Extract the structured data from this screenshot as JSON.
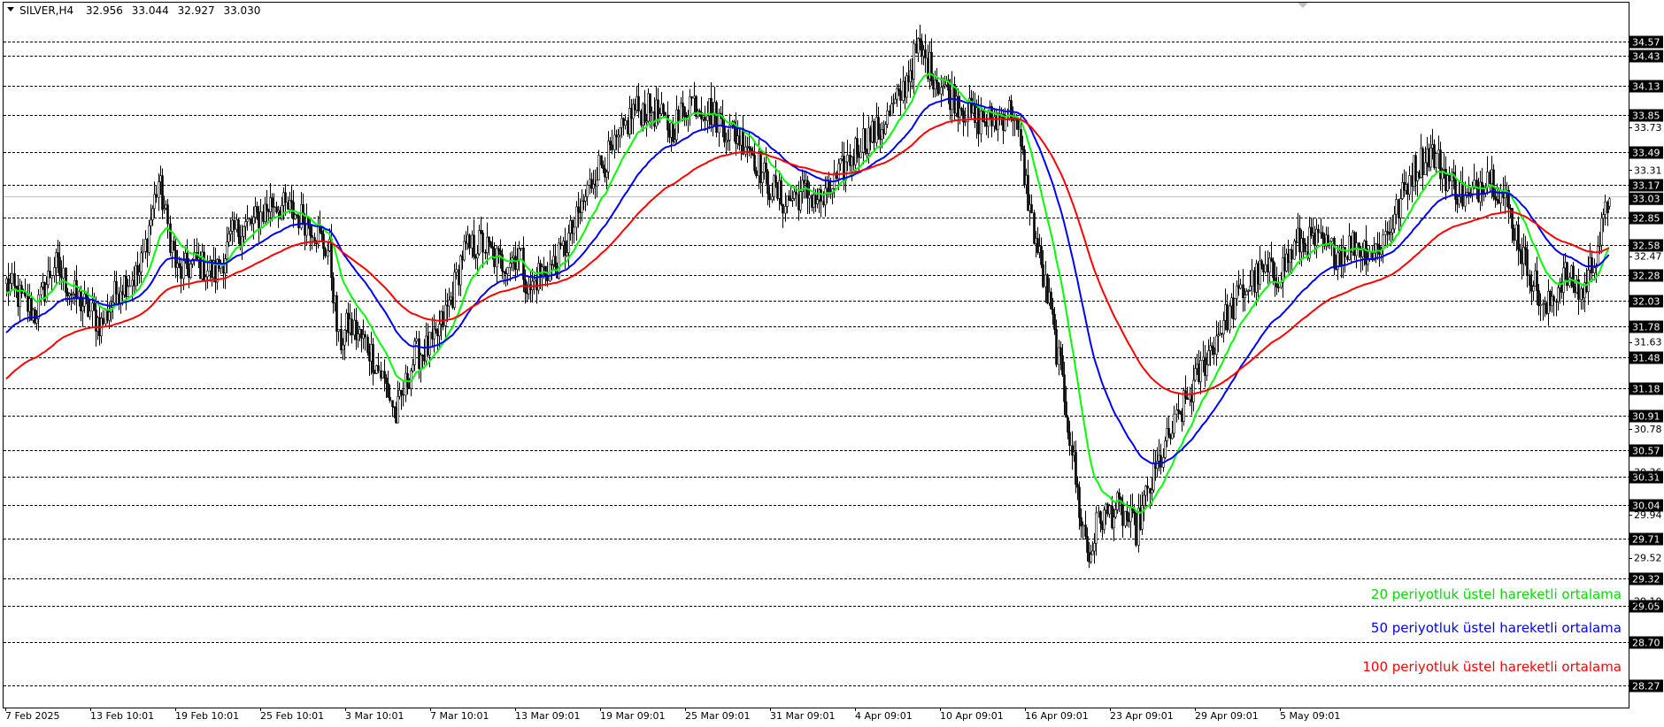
{
  "chart_data": {
    "type": "candlestick",
    "title": {
      "symbol": "SILVER,H4",
      "open": "32.956",
      "high": "33.044",
      "low": "32.927",
      "close": "33.030"
    },
    "y_range": [
      28.1,
      34.8
    ],
    "time_labels": [
      "7 Feb 2025",
      "13 Feb 10:01",
      "19 Feb 10:01",
      "25 Feb 10:01",
      "3 Mar 10:01",
      "7 Mar 10:01",
      "13 Mar 09:01",
      "19 Mar 09:01",
      "25 Mar 09:01",
      "31 Mar 09:01",
      "4 Apr 09:01",
      "10 Apr 09:01",
      "16 Apr 09:01",
      "23 Apr 09:01",
      "29 Apr 09:01",
      "5 May 09:01"
    ],
    "level_lines": [
      "34.57",
      "34.43",
      "34.13",
      "33.85",
      "33.49",
      "33.17",
      "32.85",
      "32.58",
      "32.28",
      "32.03",
      "31.78",
      "31.48",
      "31.18",
      "30.91",
      "30.57",
      "30.31",
      "30.04",
      "29.71",
      "29.32",
      "29.05",
      "28.70",
      "28.27"
    ],
    "scale_labels": [
      "33.73",
      "33.31",
      "32.47",
      "31.63",
      "30.78",
      "30.36",
      "29.94",
      "29.52",
      "29.10"
    ],
    "current_price": "33.03",
    "price_path": [
      [
        0,
        32.2
      ],
      [
        15,
        31.9
      ],
      [
        25,
        32.4
      ],
      [
        35,
        32.1
      ],
      [
        50,
        31.8
      ],
      [
        60,
        32.2
      ],
      [
        70,
        32.3
      ],
      [
        80,
        33.2
      ],
      [
        90,
        32.3
      ],
      [
        100,
        32.4
      ],
      [
        110,
        32.3
      ],
      [
        120,
        32.7
      ],
      [
        130,
        32.8
      ],
      [
        140,
        33.0
      ],
      [
        150,
        32.9
      ],
      [
        160,
        32.8
      ],
      [
        170,
        32.5
      ],
      [
        175,
        31.6
      ],
      [
        180,
        31.8
      ],
      [
        190,
        31.6
      ],
      [
        200,
        31.2
      ],
      [
        205,
        30.9
      ],
      [
        210,
        31.2
      ],
      [
        215,
        31.5
      ],
      [
        225,
        31.6
      ],
      [
        235,
        32.1
      ],
      [
        240,
        32.5
      ],
      [
        250,
        32.6
      ],
      [
        260,
        32.4
      ],
      [
        270,
        32.5
      ],
      [
        275,
        32.1
      ],
      [
        280,
        32.3
      ],
      [
        290,
        32.4
      ],
      [
        300,
        32.8
      ],
      [
        310,
        33.3
      ],
      [
        320,
        33.5
      ],
      [
        330,
        33.9
      ],
      [
        340,
        33.9
      ],
      [
        350,
        33.7
      ],
      [
        360,
        34.0
      ],
      [
        370,
        33.9
      ],
      [
        380,
        33.7
      ],
      [
        390,
        33.6
      ],
      [
        400,
        33.2
      ],
      [
        410,
        33.0
      ],
      [
        420,
        33.1
      ],
      [
        430,
        33.0
      ],
      [
        440,
        33.3
      ],
      [
        450,
        33.6
      ],
      [
        460,
        33.7
      ],
      [
        470,
        34.0
      ],
      [
        480,
        34.5
      ],
      [
        490,
        34.2
      ],
      [
        500,
        34.0
      ],
      [
        510,
        33.8
      ],
      [
        520,
        33.8
      ],
      [
        530,
        33.9
      ],
      [
        535,
        33.4
      ],
      [
        540,
        32.8
      ],
      [
        550,
        31.9
      ],
      [
        558,
        31.0
      ],
      [
        565,
        30.0
      ],
      [
        570,
        29.5
      ],
      [
        575,
        29.9
      ],
      [
        585,
        30.0
      ],
      [
        595,
        29.8
      ],
      [
        600,
        30.1
      ],
      [
        610,
        30.6
      ],
      [
        620,
        31.0
      ],
      [
        630,
        31.4
      ],
      [
        640,
        31.8
      ],
      [
        650,
        32.1
      ],
      [
        660,
        32.3
      ],
      [
        670,
        32.3
      ],
      [
        680,
        32.6
      ],
      [
        690,
        32.6
      ],
      [
        700,
        32.5
      ],
      [
        710,
        32.6
      ],
      [
        720,
        32.5
      ],
      [
        730,
        32.8
      ],
      [
        740,
        33.3
      ],
      [
        750,
        33.5
      ],
      [
        760,
        33.2
      ],
      [
        770,
        33.0
      ],
      [
        780,
        33.3
      ],
      [
        790,
        33.0
      ],
      [
        800,
        32.4
      ],
      [
        805,
        32.2
      ],
      [
        810,
        31.9
      ],
      [
        820,
        32.3
      ],
      [
        830,
        32.1
      ],
      [
        835,
        32.4
      ],
      [
        840,
        32.7
      ],
      [
        844,
        33.03
      ]
    ],
    "series": [
      {
        "name": "20 periyotluk üstel hareketli ortalama",
        "color": "#00ff00",
        "period": 20
      },
      {
        "name": "50 periyotluk üstel hareketli ortalama",
        "color": "#0000ff",
        "period": 50
      },
      {
        "name": "100 periyotluk üstel hareketli ortalama",
        "color": "#ff0000",
        "period": 100
      }
    ]
  }
}
